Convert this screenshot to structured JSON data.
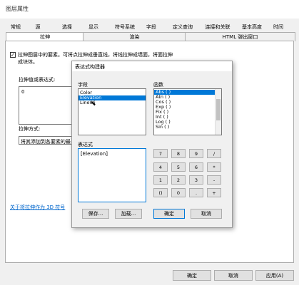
{
  "window": {
    "title": "图层属性"
  },
  "tabs_row1": [
    "常规",
    "源",
    "选择",
    "显示",
    "符号系统",
    "字段",
    "定义查询",
    "连接和关联",
    "基本高度",
    "时间"
  ],
  "tabs_row2": [
    "拉伸",
    "渲染",
    "HTML 弹出窗口"
  ],
  "extrude": {
    "checkbox_label_1": "拉伸图层中的要素。可将点拉伸成垂直线，将线拉伸成墙面，将面拉伸",
    "checkbox_label_2": "成块体。",
    "expression_label": "拉伸值或表达式:",
    "expression_value": "0",
    "method_label": "拉伸方式:",
    "method_value": "将其添加到各要素的最",
    "link_text": "关于将拉伸作为 3D 符号"
  },
  "dialog": {
    "title": "表达式构建器",
    "fields_label": "字段",
    "fields": [
      "Color",
      "Elevation",
      "LineWi"
    ],
    "selected_field": "Elevation",
    "functions_label": "函数",
    "functions": [
      "Abs ( )",
      "Atn ( )",
      "Cos ( )",
      "Exp ( )",
      "Fix ( )",
      "Int ( )",
      "Log ( )",
      "Sin ( )"
    ],
    "selected_function": "Abs ( )",
    "expression_label": "表达式",
    "expression": "[Elevation]",
    "keypad": [
      [
        "7",
        "8",
        "9",
        "/"
      ],
      [
        "4",
        "5",
        "6",
        "*"
      ],
      [
        "1",
        "2",
        "3",
        "-"
      ],
      [
        "()",
        "0",
        ".",
        "+"
      ]
    ],
    "save_label": "保存...",
    "load_label": "加载...",
    "ok_label": "确定",
    "cancel_label": "取消"
  },
  "footer": {
    "ok": "确定",
    "cancel": "取消",
    "apply": "应用(A)"
  }
}
